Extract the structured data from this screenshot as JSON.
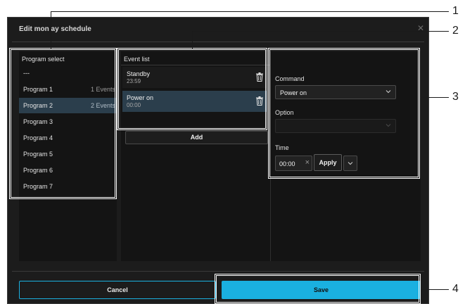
{
  "dialog": {
    "title": "Edit mon  ay schedule",
    "close_icon": "close-icon"
  },
  "program_select": {
    "header": "Program select",
    "items": [
      {
        "label": "---",
        "count": ""
      },
      {
        "label": "Program 1",
        "count": "1 Events"
      },
      {
        "label": "Program 2",
        "count": "2 Events",
        "selected": true
      },
      {
        "label": "Program 3",
        "count": ""
      },
      {
        "label": "Program 4",
        "count": ""
      },
      {
        "label": "Program 5",
        "count": ""
      },
      {
        "label": "Program 6",
        "count": ""
      },
      {
        "label": "Program 7",
        "count": ""
      }
    ]
  },
  "event_list": {
    "header": "Event list",
    "events": [
      {
        "name": "Standby",
        "time": "23:59",
        "icon": "trash-icon"
      },
      {
        "name": "Power on",
        "time": "00:00",
        "icon": "trash-icon",
        "selected": true
      }
    ],
    "add_label": "Add"
  },
  "editor": {
    "command_label": "Command",
    "command_value": "Power on",
    "option_label": "Option",
    "option_value": "",
    "time_label": "Time",
    "time_value": "00:00",
    "clear_glyph": "×",
    "apply_label": "Apply"
  },
  "footer": {
    "cancel_label": "Cancel",
    "save_label": "Save"
  },
  "callouts": [
    "1",
    "2",
    "3",
    "4"
  ],
  "colors": {
    "dialog_bg": "#1c1c1c",
    "panel_bg": "#141414",
    "selected_bg": "#2b3e4c",
    "accent": "#1ab0e0",
    "highlight_border": "#ffffff"
  }
}
